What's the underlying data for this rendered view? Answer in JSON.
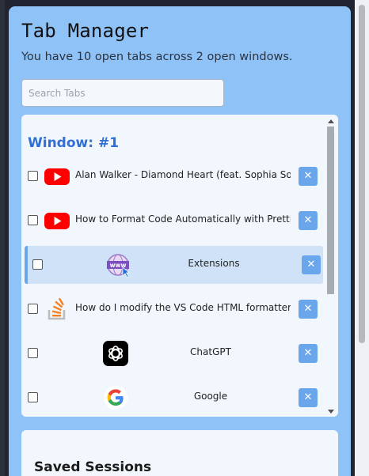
{
  "app": {
    "title": "Tab Manager",
    "subtitle": "You have 10 open tabs across 2 open windows."
  },
  "search": {
    "placeholder": "Search Tabs",
    "value": ""
  },
  "window": {
    "title": "Window: #1",
    "tabs": [
      {
        "title": "Alan Walker - Diamond Heart (feat. Sophia Somajo)",
        "icon": "youtube-icon",
        "layout": "inline",
        "active": false
      },
      {
        "title": "How to Format Code Automatically with Prettier and",
        "icon": "youtube-icon",
        "layout": "inline",
        "active": false
      },
      {
        "title": "Extensions",
        "icon": "www-globe-icon",
        "layout": "centered",
        "active": true
      },
      {
        "title": "How do I modify the VS Code HTML formatter? - Stack",
        "icon": "stackoverflow-icon",
        "layout": "inline",
        "active": false
      },
      {
        "title": "ChatGPT",
        "icon": "chatgpt-icon",
        "layout": "centered",
        "active": false
      },
      {
        "title": "Google",
        "icon": "google-icon",
        "layout": "centered",
        "active": false
      }
    ],
    "close_label": "✕"
  },
  "sessions": {
    "title": "Saved Sessions"
  },
  "colors": {
    "panel_bg": "#8fc2f7",
    "card_bg": "#f2f7fd",
    "accent": "#2f6fd6",
    "close_button": "#6aa6ec",
    "active_row": "#cfe2f7"
  }
}
